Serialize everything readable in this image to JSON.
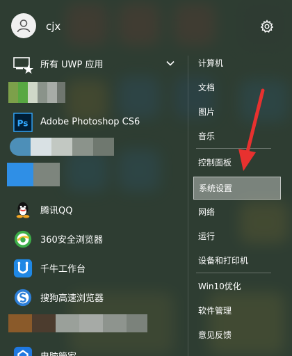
{
  "user": {
    "name": "cjx"
  },
  "apps": {
    "group_label": "所有 UWP 应用",
    "photoshop": "Adobe Photoshop CS6",
    "qq": "腾讯QQ",
    "browser360": "360安全浏览器",
    "qianniu": "千牛工作台",
    "sogou": "搜狗高速浏览器",
    "partial": "电脑管家"
  },
  "links": [
    "计算机",
    "文档",
    "图片",
    "音乐",
    "控制面板",
    "系统设置",
    "网络",
    "运行",
    "设备和打印机",
    "Win10优化",
    "软件管理",
    "意见反馈"
  ],
  "colors": {
    "highlight": "#b9beb9",
    "arrow": "#e8312f",
    "ps_blue": "#001e36",
    "browser360": "#3dae49",
    "qianniu": "#1f88e5",
    "sogou": "#2d7fd8"
  },
  "icons": {
    "avatar": "user-avatar-icon",
    "settings": "gear-icon",
    "group": "uwp-apps-icon",
    "expand": "chevron-down-icon"
  }
}
